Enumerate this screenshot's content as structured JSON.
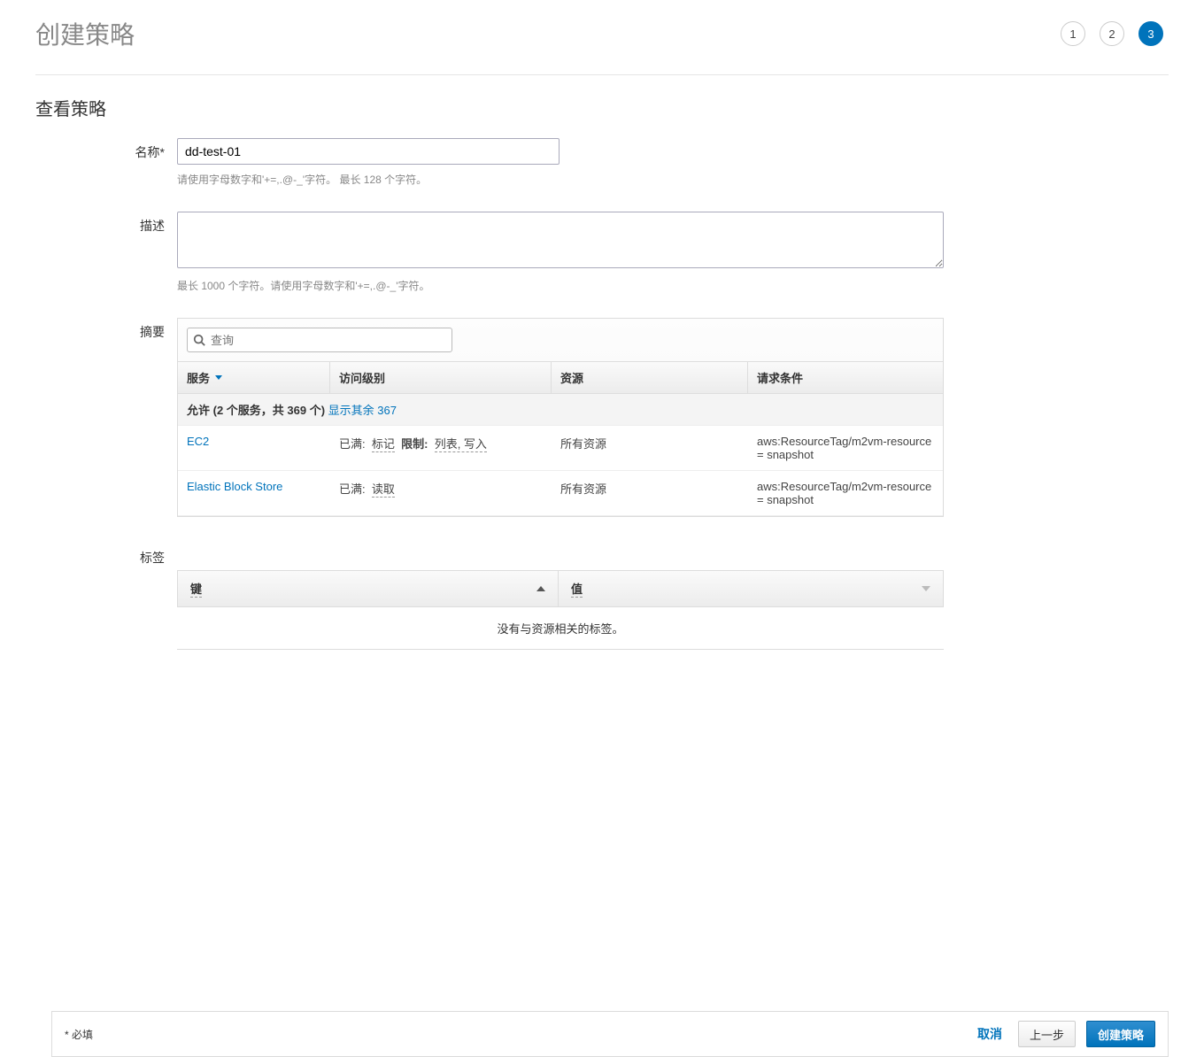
{
  "header": {
    "title": "创建策略",
    "steps": [
      "1",
      "2",
      "3"
    ],
    "activeStep": 3
  },
  "section": {
    "review_title": "查看策略"
  },
  "form": {
    "name_label": "名称*",
    "name_value": "dd-test-01",
    "name_help": "请使用字母数字和'+=,.@-_'字符。 最长 128 个字符。",
    "desc_label": "描述",
    "desc_value": "",
    "desc_help": "最长 1000 个字符。请使用字母数字和'+=,.@-_'字符。",
    "summary_label": "摘要",
    "tags_label": "标签"
  },
  "summary": {
    "search_placeholder": "查询",
    "headers": {
      "service": "服务",
      "access": "访问级别",
      "resource": "资源",
      "request": "请求条件"
    },
    "allow_line_prefix": "允许 (2 个服务，共 369 个)",
    "show_rest_link": "显示其余 367",
    "rows": [
      {
        "service": "EC2",
        "access_status": "已满:",
        "access_tag": "标记",
        "access_limit_label": "限制:",
        "access_limit_values": "列表, 写入",
        "resource": "所有资源",
        "request": "aws:ResourceTag/m2vm-resource = snapshot"
      },
      {
        "service": "Elastic Block Store",
        "access_status": "已满:",
        "access_tag": "读取",
        "access_limit_label": "",
        "access_limit_values": "",
        "resource": "所有资源",
        "request": "aws:ResourceTag/m2vm-resource = snapshot"
      }
    ]
  },
  "tags": {
    "headers": {
      "key": "键",
      "value": "值"
    },
    "empty": "没有与资源相关的标签。"
  },
  "footer": {
    "required": "* 必填",
    "cancel": "取消",
    "prev": "上一步",
    "create": "创建策略"
  }
}
